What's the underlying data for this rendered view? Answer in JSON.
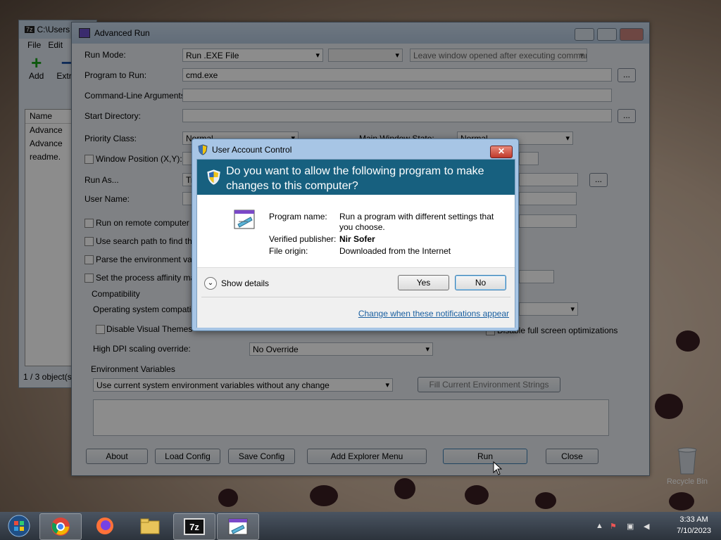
{
  "zip_window": {
    "title": "C:\\Users",
    "menu": [
      "File",
      "Edit"
    ],
    "tools": [
      "Add",
      "Extra"
    ],
    "column_name": "Name",
    "files": [
      "Advance",
      "Advance",
      "readme."
    ],
    "status": "1 / 3 object(s"
  },
  "advanced_run": {
    "title": "Advanced Run",
    "labels": {
      "run_mode": "Run Mode:",
      "program": "Program to Run:",
      "args": "Command-Line Arguments:",
      "start_dir": "Start Directory:",
      "priority": "Priority Class:",
      "main_window_state": "Main Window State:",
      "window_position": "Window Position (X,Y):",
      "run_as": "Run As...",
      "user_name": "User Name:",
      "remote": "Run on remote computer wit",
      "search_path": "Use search path to find the",
      "parse_env": "Parse the environment varia",
      "affinity": "Set the process affinity mas",
      "compat_group": "Compatibility",
      "os_compat": "Operating system compatibili",
      "disable_themes": "Disable Visual Themes",
      "disable_fullscreen": "Disable full screen optimizations",
      "high_dpi": "High DPI scaling override:",
      "env_vars": "Environment Variables"
    },
    "values": {
      "run_mode": "Run .EXE File",
      "window_option": "Leave window opened after executing comman",
      "program": "cmd.exe",
      "priority": "Normal",
      "main_window_state": "Normal",
      "run_as": "Tr",
      "high_dpi": "No Override",
      "env_mode": "Use current system environment variables without any change"
    },
    "browse": "...",
    "fill_env_button": "Fill Current Environment Strings",
    "buttons": {
      "about": "About",
      "load": "Load Config",
      "save": "Save Config",
      "explorer": "Add Explorer Menu",
      "run": "Run",
      "close": "Close"
    }
  },
  "uac": {
    "title": "User Account Control",
    "question": "Do you want to allow the following program to make changes to this computer?",
    "program_name_label": "Program name:",
    "program_name": "Run a program with different settings that you choose.",
    "publisher_label": "Verified publisher:",
    "publisher": "Nir Sofer",
    "origin_label": "File origin:",
    "origin": "Downloaded from the Internet",
    "show_details": "Show details",
    "yes": "Yes",
    "no": "No",
    "link": "Change when these notifications appear",
    "close_glyph": "✕"
  },
  "desktop": {
    "recycle_bin": "Recycle Bin"
  },
  "taskbar": {
    "apps": [
      "start-orb-icon",
      "chrome-icon",
      "firefox-icon",
      "explorer-icon",
      "7zip-icon",
      "advancedrun-icon"
    ],
    "zip_label": "7z",
    "time": "3:33 AM",
    "date": "7/10/2023"
  }
}
